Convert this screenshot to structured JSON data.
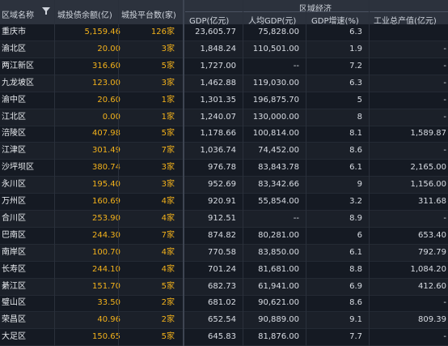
{
  "header": {
    "region": "区域名称",
    "debt": "城投债余额(亿)",
    "platforms": "城投平台数(家)",
    "group": "区域经济",
    "gdp": "GDP(亿元)",
    "per_capita": "人均GDP(元)",
    "growth": "GDP增速(%)",
    "industrial": "工业总产值(亿元)"
  },
  "rows": [
    {
      "name": "重庆市",
      "debt": "5,159.46",
      "plat": "126家",
      "gdp": "23,605.77",
      "pgdp": "75,828.00",
      "grow": "6.3",
      "ind": ""
    },
    {
      "name": "渝北区",
      "debt": "20.00",
      "plat": "3家",
      "gdp": "1,848.24",
      "pgdp": "110,501.00",
      "grow": "1.9",
      "ind": "-"
    },
    {
      "name": "两江新区",
      "debt": "316.60",
      "plat": "5家",
      "gdp": "1,727.00",
      "pgdp": "--",
      "grow": "7.2",
      "ind": "-"
    },
    {
      "name": "九龙坡区",
      "debt": "123.00",
      "plat": "3家",
      "gdp": "1,462.88",
      "pgdp": "119,030.00",
      "grow": "6.3",
      "ind": "-"
    },
    {
      "name": "渝中区",
      "debt": "20.60",
      "plat": "1家",
      "gdp": "1,301.35",
      "pgdp": "196,875.70",
      "grow": "5",
      "ind": "-"
    },
    {
      "name": "江北区",
      "debt": "0.00",
      "plat": "1家",
      "gdp": "1,240.07",
      "pgdp": "130,000.00",
      "grow": "8",
      "ind": "-"
    },
    {
      "name": "涪陵区",
      "debt": "407.98",
      "plat": "5家",
      "gdp": "1,178.66",
      "pgdp": "100,814.00",
      "grow": "8.1",
      "ind": "1,589.87"
    },
    {
      "name": "江津区",
      "debt": "301.49",
      "plat": "7家",
      "gdp": "1,036.74",
      "pgdp": "74,452.00",
      "grow": "8.6",
      "ind": "-"
    },
    {
      "name": "沙坪坝区",
      "debt": "380.74",
      "plat": "3家",
      "gdp": "976.78",
      "pgdp": "83,843.78",
      "grow": "6.1",
      "ind": "2,165.00"
    },
    {
      "name": "永川区",
      "debt": "195.40",
      "plat": "3家",
      "gdp": "952.69",
      "pgdp": "83,342.66",
      "grow": "9",
      "ind": "1,156.00"
    },
    {
      "name": "万州区",
      "debt": "160.69",
      "plat": "4家",
      "gdp": "920.91",
      "pgdp": "55,854.00",
      "grow": "3.2",
      "ind": "311.68"
    },
    {
      "name": "合川区",
      "debt": "253.90",
      "plat": "4家",
      "gdp": "912.51",
      "pgdp": "--",
      "grow": "8.9",
      "ind": "-"
    },
    {
      "name": "巴南区",
      "debt": "244.30",
      "plat": "7家",
      "gdp": "874.82",
      "pgdp": "80,281.00",
      "grow": "6",
      "ind": "653.40"
    },
    {
      "name": "南岸区",
      "debt": "100.70",
      "plat": "4家",
      "gdp": "770.58",
      "pgdp": "83,850.00",
      "grow": "6.1",
      "ind": "792.79"
    },
    {
      "name": "长寿区",
      "debt": "244.10",
      "plat": "4家",
      "gdp": "701.24",
      "pgdp": "81,681.00",
      "grow": "8.8",
      "ind": "1,084.20"
    },
    {
      "name": "綦江区",
      "debt": "151.70",
      "plat": "5家",
      "gdp": "682.73",
      "pgdp": "61,941.00",
      "grow": "6.9",
      "ind": "412.60"
    },
    {
      "name": "璧山区",
      "debt": "33.50",
      "plat": "2家",
      "gdp": "681.02",
      "pgdp": "90,621.00",
      "grow": "8.6",
      "ind": "-"
    },
    {
      "name": "荣昌区",
      "debt": "40.96",
      "plat": "2家",
      "gdp": "652.54",
      "pgdp": "90,889.00",
      "grow": "9.1",
      "ind": "809.39"
    },
    {
      "name": "大足区",
      "debt": "150.65",
      "plat": "5家",
      "gdp": "645.83",
      "pgdp": "81,876.00",
      "grow": "7.7",
      "ind": "-"
    }
  ]
}
